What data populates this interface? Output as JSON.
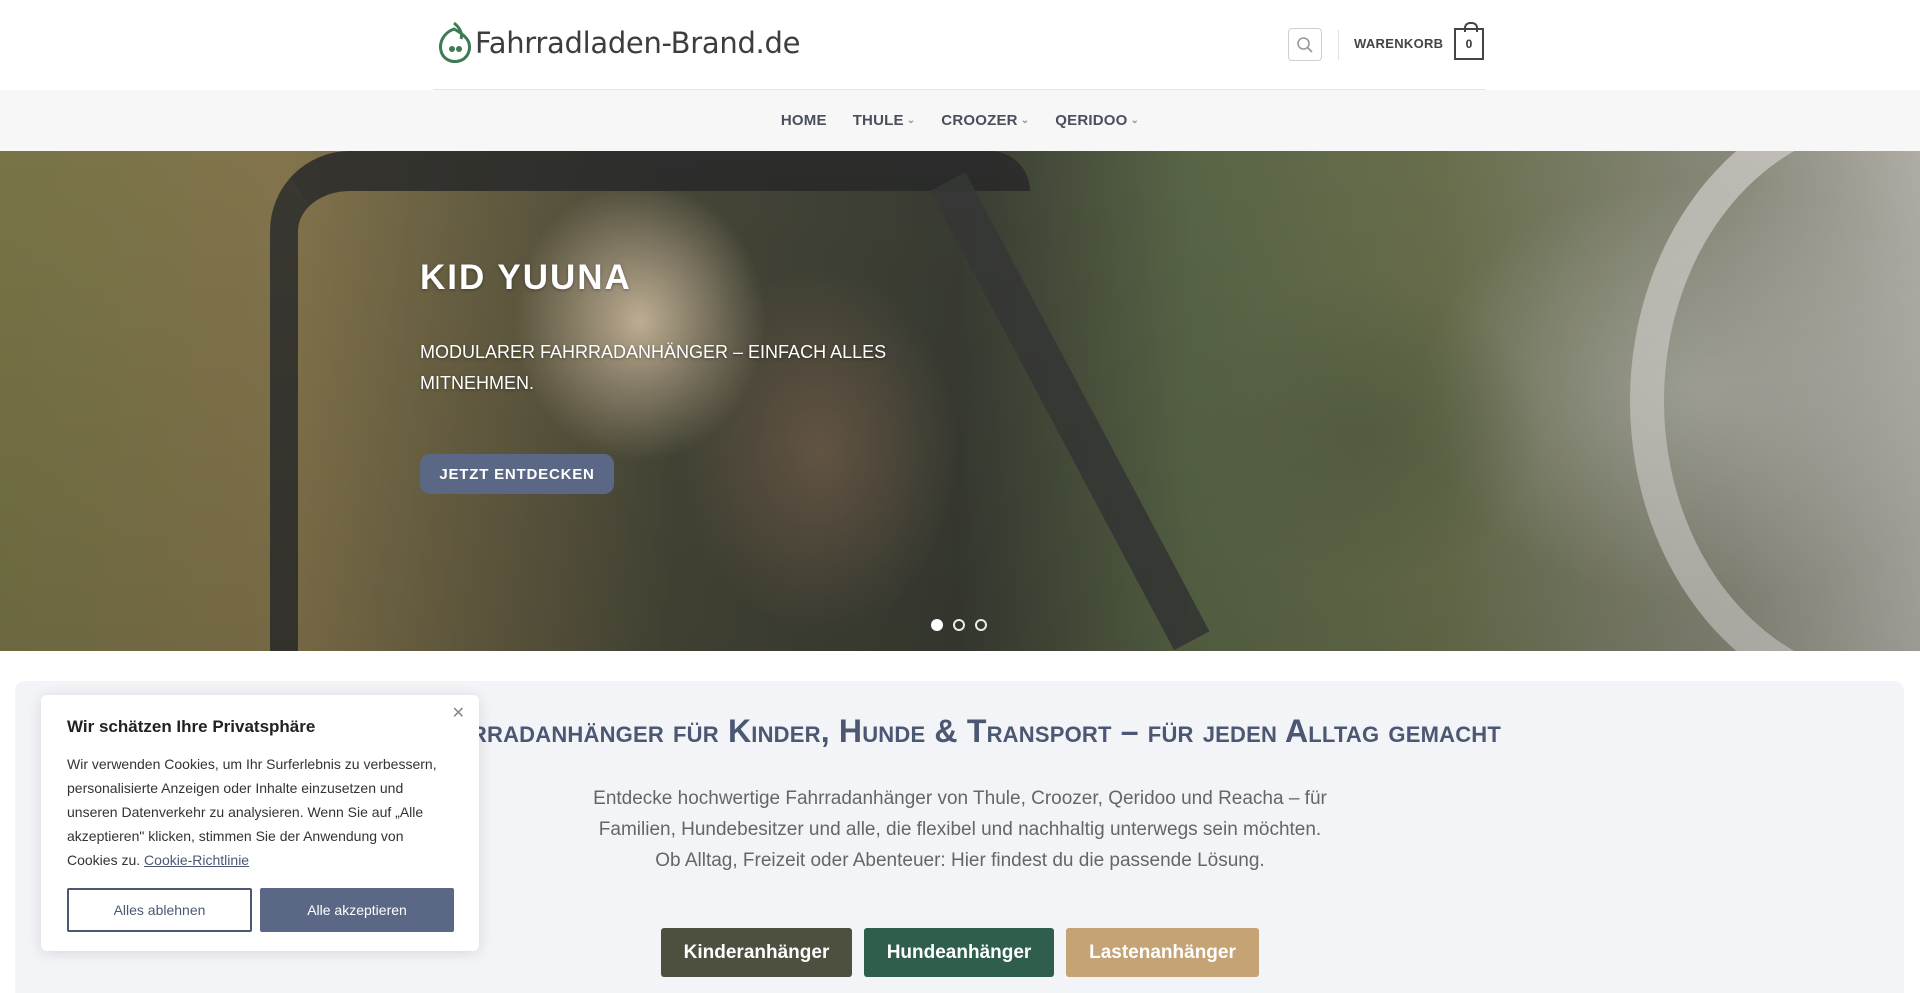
{
  "header": {
    "logo_text": "Fahrradladen-Brand.de",
    "cart_label": "WARENKORB",
    "cart_count": "0"
  },
  "nav": {
    "items": [
      {
        "label": "HOME"
      },
      {
        "label": "THULE"
      },
      {
        "label": "CROOZER"
      },
      {
        "label": "QERIDOO"
      }
    ]
  },
  "hero": {
    "title": "KID YUUNA",
    "subtitle": "MODULARER FAHRRADANHÄNGER – EINFACH ALLES MITNEHMEN.",
    "button_label": "JETZT ENTDECKEN",
    "slide_count": 3,
    "active_slide": 1
  },
  "section": {
    "title": "Fahrradanhänger für Kinder, Hunde & Transport – für jeden Alltag gemacht",
    "text_line1": "Entdecke hochwertige Fahrradanhänger von Thule, Croozer, Qeridoo und Reacha – für Familien, Hundebesitzer und alle, die flexibel und nachhaltig unterwegs sein möchten.",
    "text_line2": "Ob Alltag, Freizeit oder Abenteuer: Hier findest du die passende Lösung.",
    "buttons": [
      {
        "label": "Kinderanhänger",
        "color": "#4d4f3f"
      },
      {
        "label": "Hundeanhänger",
        "color": "#2f5f4c"
      },
      {
        "label": "Lastenanhänger",
        "color": "#c5a374"
      }
    ]
  },
  "cookie": {
    "title": "Wir schätzen Ihre Privatsphäre",
    "text": "Wir verwenden Cookies, um Ihr Surferlebnis zu verbessern, personalisierte Anzeigen oder Inhalte einzusetzen und unseren Datenverkehr zu analysieren. Wenn Sie auf „Alle akzeptieren\" klicken, stimmen Sie der Anwendung von Cookies zu.",
    "link_label": "Cookie-Richtlinie",
    "reject_label": "Alles ablehnen",
    "accept_label": "Alle akzeptieren",
    "close_icon": "close-icon"
  },
  "colors": {
    "accent": "#5b6885",
    "title_color": "#4c5773"
  }
}
